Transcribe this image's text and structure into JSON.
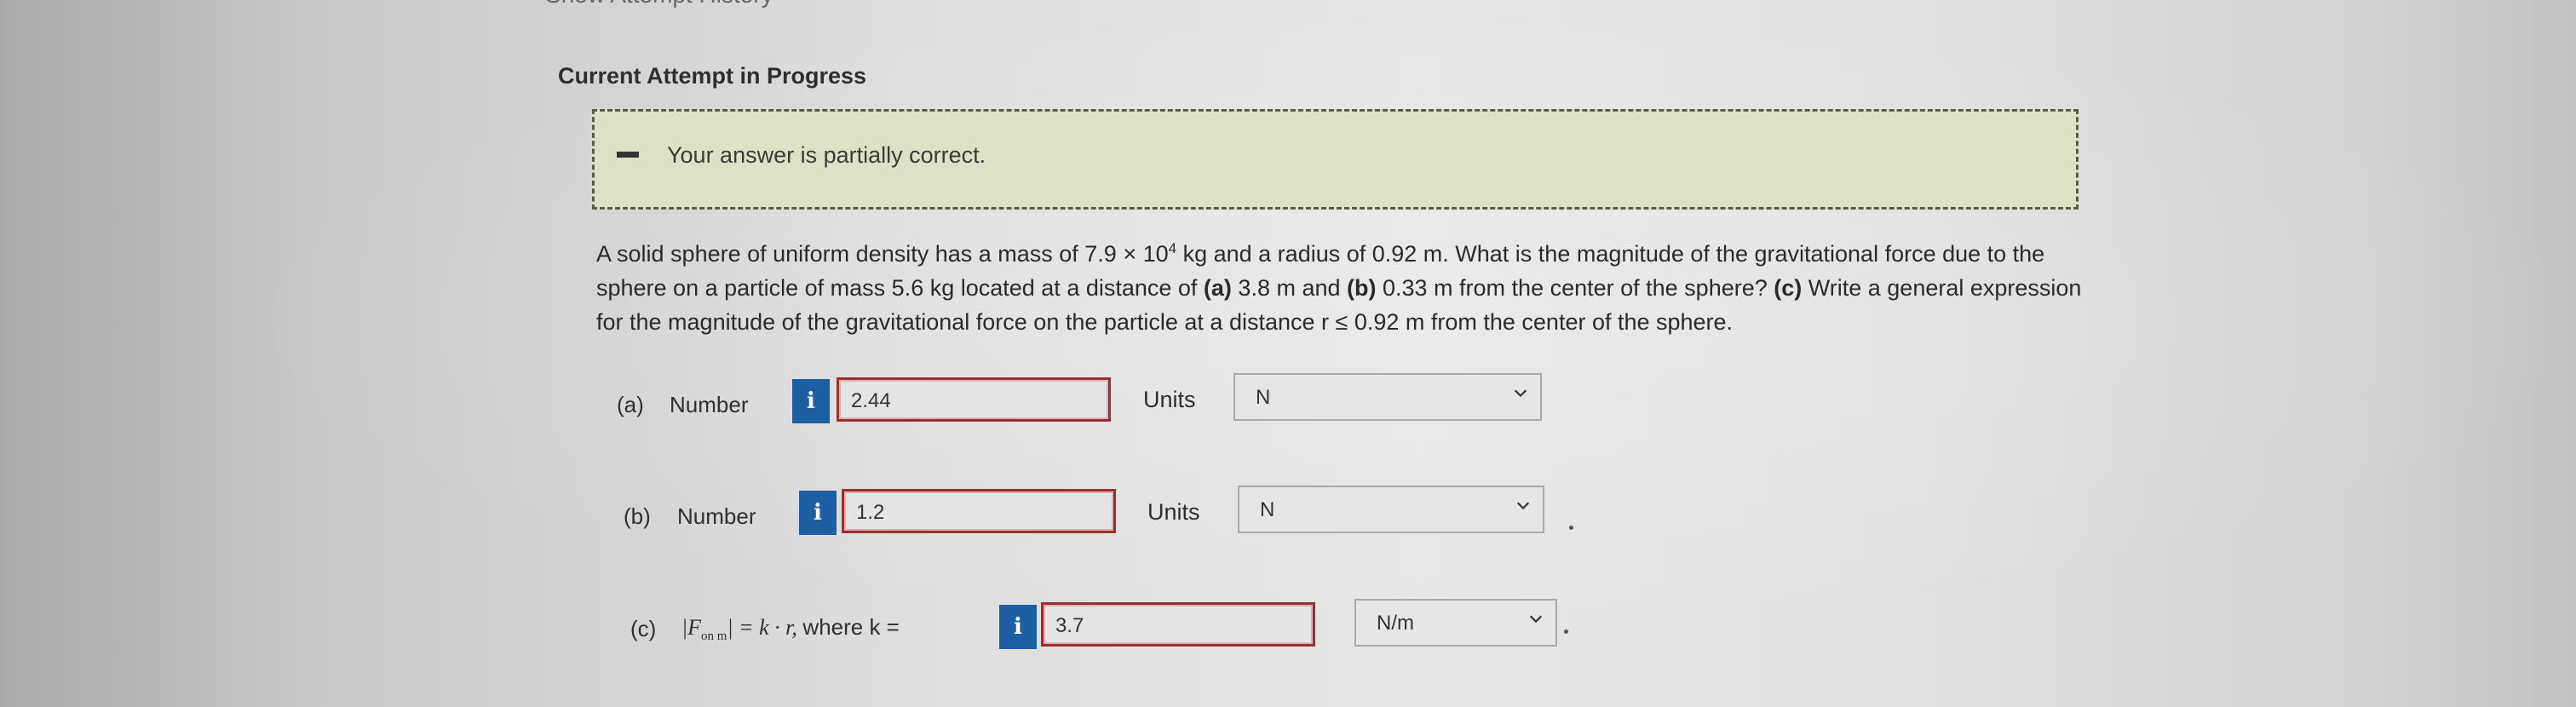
{
  "header": {
    "cut_text": "Show Attempt History",
    "title": "Current Attempt in Progress"
  },
  "banner": {
    "message": "Your answer is partially correct.",
    "icon": "dash-icon"
  },
  "question": {
    "seg1": "A solid sphere of uniform density has a mass of 7.9 × 10",
    "exp": "4",
    "seg2": " kg and a radius of 0.92 m. What is the magnitude of the gravitational force due to the sphere on a particle of mass 5.6 kg located at a distance of ",
    "a": "(a)",
    "seg3": " 3.8 m and ",
    "b": "(b)",
    "seg4": " 0.33 m from the center of the sphere? ",
    "c": "(c)",
    "seg5": " Write a general expression for the magnitude of the gravitational force on the particle at a distance r ≤ 0.92 m from the center of the sphere."
  },
  "parts": {
    "a": {
      "label": "(a)",
      "number_label": "Number",
      "info": "i",
      "value": "2.44",
      "units_label": "Units",
      "unit": "N"
    },
    "b": {
      "label": "(b)",
      "number_label": "Number",
      "info": "i",
      "value": "1.2",
      "units_label": "Units",
      "unit": "N"
    },
    "c": {
      "label": "(c)",
      "formula_pre": "|F",
      "formula_sub": "on m",
      "formula_post": "| = k · r,",
      "where": "where k =",
      "info": "i",
      "value": "3.7",
      "unit": "N/m"
    }
  },
  "colors": {
    "banner_bg": "#dfe1c7",
    "info_blue": "#1e5fa4",
    "error_border": "#9b2f2f"
  }
}
